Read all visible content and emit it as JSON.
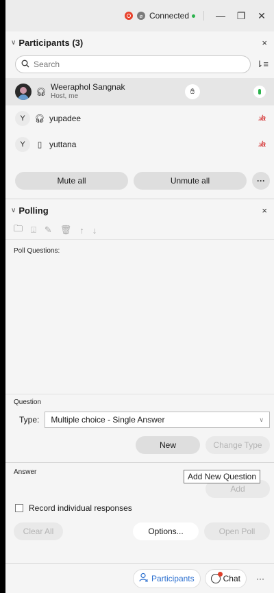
{
  "titlebar": {
    "status": "Connected",
    "minimize": "—",
    "restore": "❐",
    "close": "✕"
  },
  "participants": {
    "title": "Participants (3)",
    "close": "×",
    "search_placeholder": "Search",
    "list": [
      {
        "name": "Weeraphol Sangnak",
        "role": "Host, me"
      },
      {
        "name": "yupadee",
        "initial": "Y"
      },
      {
        "name": "yuttana",
        "initial": "Y"
      }
    ],
    "mute_all": "Mute all",
    "unmute_all": "Unmute all",
    "more": "···"
  },
  "polling": {
    "title": "Polling",
    "close": "×",
    "poll_questions_label": "Poll Questions:",
    "question_label": "Question",
    "type_label": "Type:",
    "type_value": "Multiple choice - Single Answer",
    "new_label": "New",
    "change_type_label": "Change Type",
    "tooltip": "Add New Question",
    "answer_label": "Answer",
    "add_label": "Add",
    "record_label": "Record individual responses",
    "clear_all": "Clear All",
    "options": "Options...",
    "open_poll": "Open Poll"
  },
  "bottombar": {
    "participants": "Participants",
    "chat": "Chat",
    "more": "···"
  },
  "colors": {
    "accent_blue": "#2b6fcf",
    "record_red": "#e8412b",
    "connected_green": "#2bb24c",
    "muted_red": "#d63b3b"
  }
}
